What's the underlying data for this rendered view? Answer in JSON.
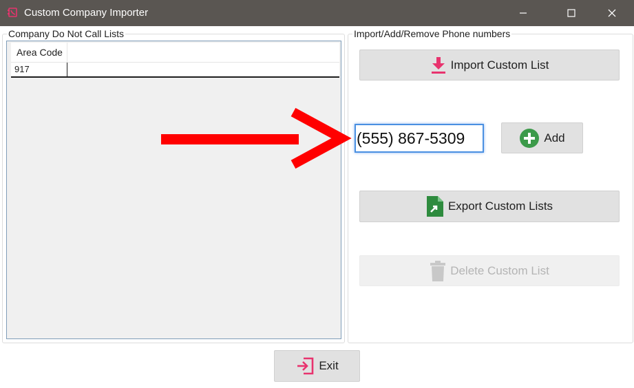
{
  "window": {
    "title": "Custom Company Importer"
  },
  "left_group": {
    "label": "Company Do Not Call Lists",
    "grid": {
      "columns": [
        "Area Code"
      ],
      "rows": [
        [
          "917"
        ]
      ]
    }
  },
  "right_group": {
    "label": "Import/Add/Remove Phone numbers",
    "import_label": "Import Custom List",
    "phone_value": "(555) 867-5309",
    "add_label": "Add",
    "export_label": "Export Custom Lists",
    "delete_label": "Delete Custom List",
    "delete_enabled": false
  },
  "footer": {
    "exit_label": "Exit"
  },
  "colors": {
    "titlebar": "#5a5652",
    "accent_pink": "#e8336e",
    "add_green": "#3c9a4a",
    "export_green": "#2e8b3e",
    "focus_blue": "#4a90e2",
    "arrow_red": "#ff0000"
  },
  "icons": {
    "app": "phone-book-icon",
    "import": "download-icon",
    "add": "plus-circle-icon",
    "export": "excel-file-icon",
    "delete": "trash-icon",
    "exit": "exit-icon"
  }
}
